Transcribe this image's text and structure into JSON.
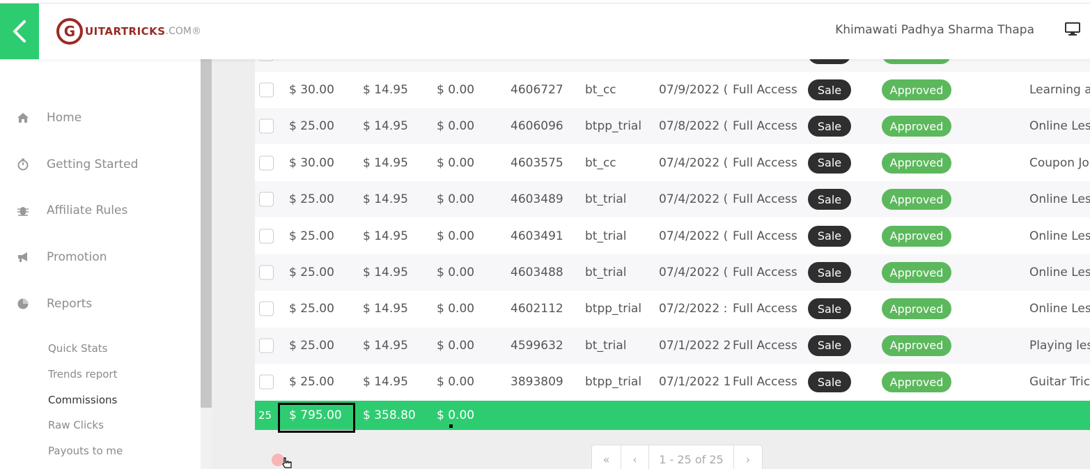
{
  "header": {
    "logo_mark": "G",
    "logo_text": "UITARTRICKS",
    "logo_suffix": ".COM®",
    "user_name": "Khimawati Padhya Sharma Thapa",
    "icons": [
      "chevron-left-icon",
      "monitor-icon"
    ]
  },
  "sidebar": {
    "items": [
      {
        "label": "Home",
        "icon": "home-icon"
      },
      {
        "label": "Getting Started",
        "icon": "stopwatch-icon"
      },
      {
        "label": "Affiliate Rules",
        "icon": "bug-icon"
      },
      {
        "label": "Promotion",
        "icon": "bullhorn-icon"
      },
      {
        "label": "Reports",
        "icon": "pie-chart-icon"
      }
    ],
    "sub_items": [
      {
        "label": "Quick Stats",
        "active": false
      },
      {
        "label": "Trends report",
        "active": false
      },
      {
        "label": "Commissions",
        "active": true
      },
      {
        "label": "Raw Clicks",
        "active": false
      },
      {
        "label": "Payouts to me",
        "active": false
      }
    ]
  },
  "table": {
    "rows": [
      {
        "amount": "$ 30.00",
        "commission": "$ 14.95",
        "fee": "$ 0.00",
        "order_id": "4606727",
        "method": "bt_cc",
        "date": "07/9/2022 (",
        "product": "Full Access",
        "type": "Sale",
        "status": "Approved",
        "description": "Learning a"
      },
      {
        "amount": "$ 25.00",
        "commission": "$ 14.95",
        "fee": "$ 0.00",
        "order_id": "4606096",
        "method": "btpp_trial",
        "date": "07/8/2022 (",
        "product": "Full Access",
        "type": "Sale",
        "status": "Approved",
        "description": "Online Les"
      },
      {
        "amount": "$ 30.00",
        "commission": "$ 14.95",
        "fee": "$ 0.00",
        "order_id": "4603575",
        "method": "bt_cc",
        "date": "07/4/2022 (",
        "product": "Full Access",
        "type": "Sale",
        "status": "Approved",
        "description": "Coupon Jo"
      },
      {
        "amount": "$ 25.00",
        "commission": "$ 14.95",
        "fee": "$ 0.00",
        "order_id": "4603489",
        "method": "bt_trial",
        "date": "07/4/2022 (",
        "product": "Full Access",
        "type": "Sale",
        "status": "Approved",
        "description": "Online Les"
      },
      {
        "amount": "$ 25.00",
        "commission": "$ 14.95",
        "fee": "$ 0.00",
        "order_id": "4603491",
        "method": "bt_trial",
        "date": "07/4/2022 (",
        "product": "Full Access",
        "type": "Sale",
        "status": "Approved",
        "description": "Online Les"
      },
      {
        "amount": "$ 25.00",
        "commission": "$ 14.95",
        "fee": "$ 0.00",
        "order_id": "4603488",
        "method": "bt_trial",
        "date": "07/4/2022 (",
        "product": "Full Access",
        "type": "Sale",
        "status": "Approved",
        "description": "Online Les"
      },
      {
        "amount": "$ 25.00",
        "commission": "$ 14.95",
        "fee": "$ 0.00",
        "order_id": "4602112",
        "method": "btpp_trial",
        "date": "07/2/2022 :",
        "product": "Full Access",
        "type": "Sale",
        "status": "Approved",
        "description": "Online Les"
      },
      {
        "amount": "$ 25.00",
        "commission": "$ 14.95",
        "fee": "$ 0.00",
        "order_id": "4599632",
        "method": "bt_trial",
        "date": "07/1/2022 2",
        "product": "Full Access",
        "type": "Sale",
        "status": "Approved",
        "description": "Playing les"
      },
      {
        "amount": "$ 25.00",
        "commission": "$ 14.95",
        "fee": "$ 0.00",
        "order_id": "3893809",
        "method": "btpp_trial",
        "date": "07/1/2022 1",
        "product": "Full Access",
        "type": "Sale",
        "status": "Approved",
        "description": "Guitar Tric"
      }
    ],
    "totals": {
      "count": "25",
      "amount": "$ 795.00",
      "commission": "$ 358.80",
      "fee": "$ 0.00"
    }
  },
  "pagination": {
    "first": "«",
    "prev": "‹",
    "range": "1 - 25 of 25",
    "next": "›"
  },
  "colors": {
    "accent_green": "#2ecc71",
    "approved_green": "#5cb85c",
    "sale_dark": "#2f2f2f",
    "logo_red": "#9b2a24"
  }
}
